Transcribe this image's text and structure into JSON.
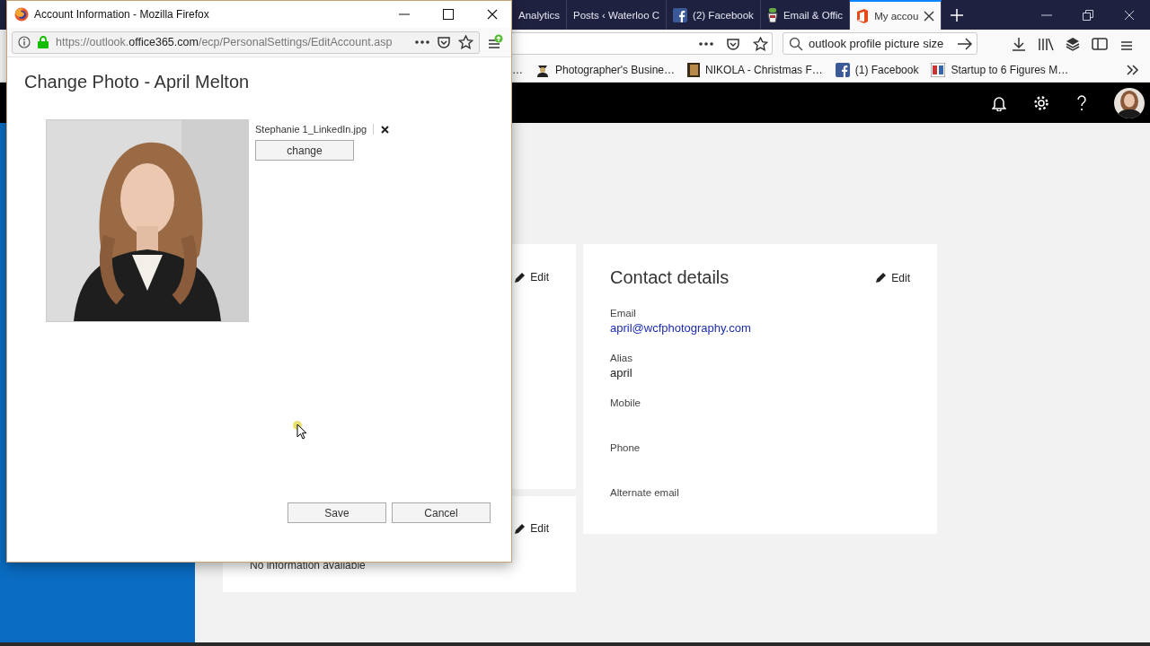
{
  "browser": {
    "tabs": [
      {
        "label": "Analytics",
        "kind": "plain",
        "selected": false
      },
      {
        "label": "Posts ‹ Waterloo C",
        "kind": "plain",
        "selected": false
      },
      {
        "label": "(2) Facebook",
        "kind": "facebook",
        "selected": false
      },
      {
        "label": "Email & Offic",
        "kind": "cup",
        "selected": false
      },
      {
        "label": "My accou",
        "kind": "office",
        "selected": true
      }
    ],
    "search": {
      "value": "outlook profile picture size"
    },
    "bookmarks": [
      {
        "label": "…",
        "kind": "plain"
      },
      {
        "label": "Photographer's Busine…",
        "kind": "person"
      },
      {
        "label": "NIKOLA - Christmas F…",
        "kind": "book"
      },
      {
        "label": "(1) Facebook",
        "kind": "facebook"
      },
      {
        "label": "Startup to 6 Figures M…",
        "kind": "grid"
      }
    ]
  },
  "left_cards": [
    {
      "edit": "Edit"
    },
    {
      "edit": "Edit",
      "note": "No information available"
    }
  ],
  "contact_card": {
    "title": "Contact details",
    "edit": "Edit",
    "fields": [
      {
        "label": "Email",
        "value": "april@wcfphotography.com",
        "kind": "link"
      },
      {
        "label": "Alias",
        "value": "april",
        "kind": "plain"
      },
      {
        "label": "Mobile"
      },
      {
        "label": "Phone"
      },
      {
        "label": "Alternate email"
      }
    ]
  },
  "popup": {
    "title": "Account Information - Mozilla Firefox",
    "url": [
      "https://outlook.",
      "office365.com",
      "/ecp/PersonalSettings/EditAccount.asp"
    ],
    "heading": "Change Photo - April Melton",
    "file_name": "Stephanie 1_LinkedIn.jpg",
    "change_button": "change",
    "buttons": [
      "Save",
      "Cancel"
    ]
  }
}
